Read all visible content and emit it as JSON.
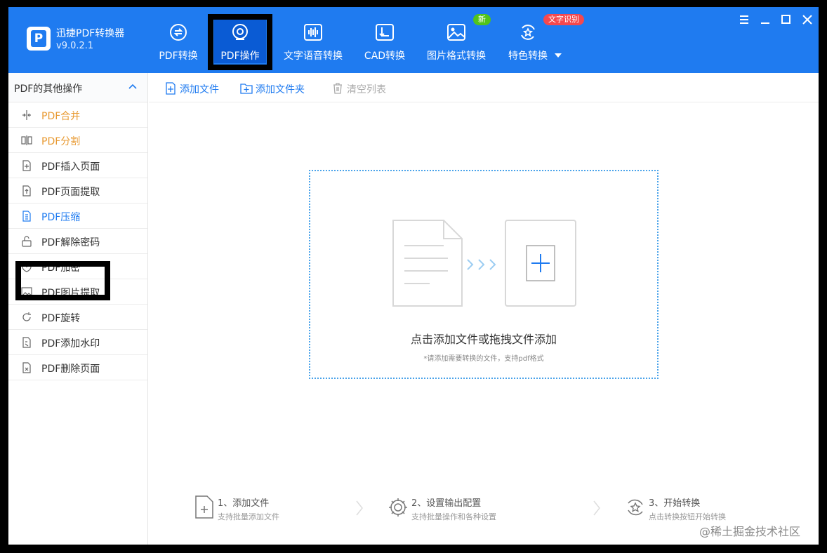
{
  "app": {
    "name": "迅捷PDF转换器",
    "version": "v9.0.2.1",
    "logo_letter": "P"
  },
  "nav": {
    "tabs": [
      {
        "label": "PDF转换",
        "icon": "pdf-convert-icon"
      },
      {
        "label": "PDF操作",
        "icon": "pdf-operate-icon",
        "active": true
      },
      {
        "label": "文字语音转换",
        "icon": "audio-wave-icon"
      },
      {
        "label": "CAD转换",
        "icon": "cad-icon"
      },
      {
        "label": "图片格式转换",
        "icon": "image-icon"
      },
      {
        "label": "特色转换",
        "icon": "star-convert-icon"
      }
    ],
    "badge_new": "新",
    "badge_ocr": "文字识别"
  },
  "window_controls": [
    "menu-icon",
    "minimize-icon",
    "maximize-icon",
    "close-icon"
  ],
  "sidebar": {
    "title": "PDF的其他操作",
    "items": [
      {
        "label": "PDF合并",
        "icon": "merge-icon",
        "state": "orange"
      },
      {
        "label": "PDF分割",
        "icon": "split-icon",
        "state": "orange"
      },
      {
        "label": "PDF插入页面",
        "icon": "insert-page-icon",
        "state": "normal"
      },
      {
        "label": "PDF页面提取",
        "icon": "extract-page-icon",
        "state": "normal"
      },
      {
        "label": "PDF压缩",
        "icon": "compress-icon",
        "state": "selected"
      },
      {
        "label": "PDF解除密码",
        "icon": "unlock-icon",
        "state": "normal"
      },
      {
        "label": "PDF加密",
        "icon": "shield-icon",
        "state": "normal"
      },
      {
        "label": "PDF图片提取",
        "icon": "image-extract-icon",
        "state": "normal"
      },
      {
        "label": "PDF旋转",
        "icon": "rotate-icon",
        "state": "normal"
      },
      {
        "label": "PDF添加水印",
        "icon": "watermark-icon",
        "state": "normal"
      },
      {
        "label": "PDF删除页面",
        "icon": "delete-page-icon",
        "state": "normal"
      }
    ]
  },
  "toolbar": {
    "add_file": "添加文件",
    "add_folder": "添加文件夹",
    "clear_list": "清空列表"
  },
  "dropzone": {
    "text": "点击添加文件或拖拽文件添加",
    "hint": "*请添加需要转换的文件，支持pdf格式"
  },
  "steps": [
    {
      "title": "1、添加文件",
      "sub": "支持批量添加文件"
    },
    {
      "title": "2、设置输出配置",
      "sub": "支持批量操作和各种设置"
    },
    {
      "title": "3、开始转换",
      "sub": "点击转换按钮开始转换"
    }
  ],
  "watermark": "@稀土掘金技术社区",
  "colors": {
    "accent": "#1f7bf0",
    "active_tab": "#0a5bd4",
    "orange_text": "#e89a32",
    "badge_new": "#52c41a",
    "badge_ocr": "#f5484d"
  }
}
